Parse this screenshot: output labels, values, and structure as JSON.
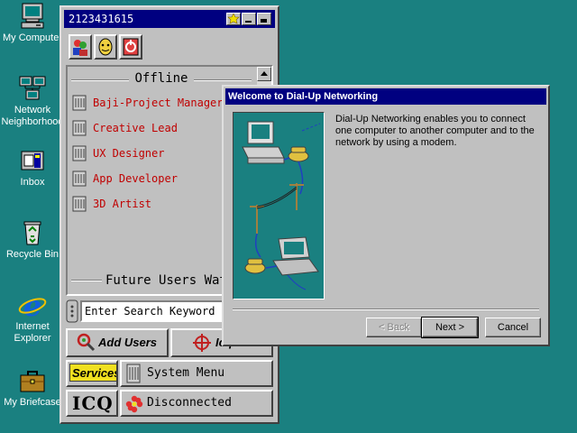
{
  "desktop": {
    "icons": [
      {
        "label": "My Computer",
        "icon": "computer-icon"
      },
      {
        "label": "Network Neighborhood",
        "label_line1": "Network",
        "label_line2": "Neighborhood",
        "icon": "network-icon"
      },
      {
        "label": "Inbox",
        "icon": "inbox-icon"
      },
      {
        "label": "Recycle Bin",
        "icon": "recycle-bin-icon"
      },
      {
        "label": "Internet Explorer",
        "label_line1": "Internet",
        "label_line2": "Explorer",
        "icon": "internet-explorer-icon"
      },
      {
        "label": "My Briefcase",
        "icon": "briefcase-icon"
      }
    ],
    "background_color": "#1a8080"
  },
  "icq": {
    "title": "2123431615",
    "toolbar": [
      "users-toolbar-icon",
      "face-toolbar-icon",
      "system-toolbar-icon"
    ],
    "group_offline": "Offline",
    "contacts": [
      {
        "name": "Baji-Project Manager"
      },
      {
        "name": "Creative Lead"
      },
      {
        "name": "UX Designer"
      },
      {
        "name": "App Developer"
      },
      {
        "name": "3D Artist"
      }
    ],
    "future_header": "Future Users Watch-",
    "search_placeholder": "Enter Search Keyword",
    "add_users_label": "Add Users",
    "icq_label": "Icq",
    "services_label": "Services",
    "system_menu_label": "System Menu",
    "logo_label": "ICQ",
    "status_label": "Disconnected",
    "contact_color": "#c00000"
  },
  "dialup": {
    "title": "Welcome to Dial-Up Networking",
    "description": "Dial-Up Networking enables you to connect one computer to another computer and to the network by using a modem.",
    "back_label": "< Back",
    "next_label": "Next >",
    "cancel_label": "Cancel",
    "titlebar_color": "#000080"
  }
}
